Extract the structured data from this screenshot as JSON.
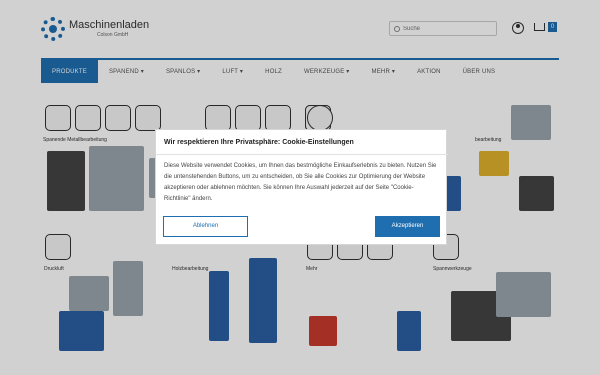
{
  "header": {
    "logo_name": "Maschinenladen",
    "logo_sub": "Colson GmbH",
    "search_placeholder": "Suche",
    "cart_count": "0"
  },
  "nav": {
    "items": [
      {
        "label": "PRODUKTE"
      },
      {
        "label": "SPANEND ▾"
      },
      {
        "label": "SPANLOS ▾"
      },
      {
        "label": "LUFT ▾"
      },
      {
        "label": "HOLZ"
      },
      {
        "label": "WERKZEUGE ▾"
      },
      {
        "label": "MEHR ▾"
      },
      {
        "label": "AKTION"
      },
      {
        "label": "ÜBER UNS"
      }
    ]
  },
  "categories": [
    {
      "label": "Spanende Metallbearbeitung"
    },
    {
      "label": "bearbeitung"
    },
    {
      "label": "Druckluft"
    },
    {
      "label": "Holzbearbeitung"
    },
    {
      "label": "Mehr"
    },
    {
      "label": "Spannwerkzeuge"
    }
  ],
  "cookie_modal": {
    "title": "Wir respektieren Ihre Privatsphäre: Cookie-Einstellungen",
    "text": "Diese Website verwendet Cookies, um Ihnen das bestmögliche Einkaufserlebnis zu bieten. Nutzen Sie die untenstehenden Buttons, um zu entscheiden, ob Sie alle Cookies zur Optimierung der Website akzeptieren oder ablehnen möchten. Sie können Ihre Auswahl jederzeit auf der Seite \"Cookie-Richtlinie\" ändern.",
    "decline_label": "Ablehnen",
    "accept_label": "Akzeptieren"
  },
  "colors": {
    "brand": "#1f6fb0"
  }
}
